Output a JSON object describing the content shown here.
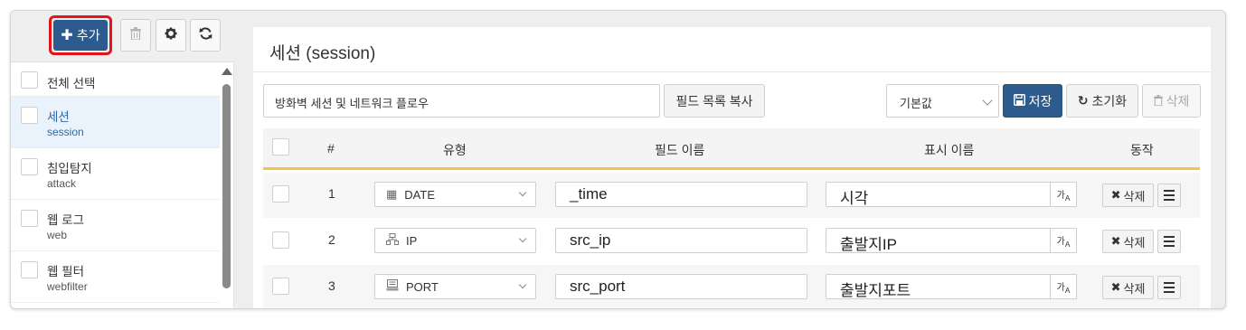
{
  "toolbar": {
    "add_label": "추가",
    "icons": [
      "plus-icon",
      "trash-icon",
      "gear-icon",
      "refresh-icon"
    ]
  },
  "sidebar": {
    "select_all_label": "전체 선택",
    "items": [
      {
        "label": "세션",
        "sub": "session",
        "selected": true
      },
      {
        "label": "침입탐지",
        "sub": "attack",
        "selected": false
      },
      {
        "label": "웹 로그",
        "sub": "web",
        "selected": false
      },
      {
        "label": "웹 필터",
        "sub": "webfilter",
        "selected": false
      }
    ]
  },
  "panel": {
    "title": "세션 (session)",
    "description_value": "방화벽 세션 및 네트워크 플로우",
    "copy_fields_label": "필드 목록 복사",
    "preset_select_value": "기본값",
    "save_label": "저장",
    "reset_label": "초기화",
    "delete_label": "삭제"
  },
  "table": {
    "headers": {
      "num": "#",
      "type": "유형",
      "field_name": "필드 이름",
      "display_name": "표시 이름",
      "action": "동작"
    },
    "rows": [
      {
        "num": "1",
        "type": "DATE",
        "type_icon": "calendar-icon",
        "field": "_time",
        "display": "시각",
        "delete_label": "삭제"
      },
      {
        "num": "2",
        "type": "IP",
        "type_icon": "network-icon",
        "field": "src_ip",
        "display": "출발지IP",
        "delete_label": "삭제"
      },
      {
        "num": "3",
        "type": "PORT",
        "type_icon": "port-icon",
        "field": "src_port",
        "display": "출발지포트",
        "delete_label": "삭제"
      }
    ]
  },
  "colors": {
    "primary": "#2e5b8e",
    "highlight_border": "#e3141b",
    "header_underline": "#f0c44b",
    "selected_item_bg": "#eaf3fb",
    "selected_item_text": "#2c6aa6"
  }
}
